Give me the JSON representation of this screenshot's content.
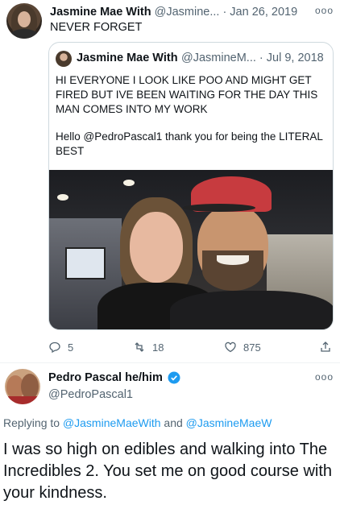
{
  "tweet": {
    "author_name": "Jasmine Mae With",
    "author_handle": "@Jasmine...",
    "date": "· Jan 26, 2019",
    "more_icon": "more-dots-icon",
    "text": "NEVER FORGET",
    "quote": {
      "author_name": "Jasmine Mae With",
      "author_handle": "@JasmineM... · Jul 9, 2018",
      "text": "HI EVERYONE I LOOK LIKE POO AND MIGHT GET FIRED BUT IVE BEEN WAITING FOR THE DAY THIS MAN COMES INTO MY WORK",
      "text2": "Hello @PedroPascal1 thank you for being the LITERAL BEST"
    },
    "actions": {
      "reply_count": "5",
      "retweet_count": "18",
      "like_count": "875"
    }
  },
  "reply": {
    "author_name": "Pedro Pascal he/him",
    "author_handle": "@PedroPascal1",
    "replying_prefix": "Replying to",
    "replying_to_1": "@JasmineMaeWith",
    "replying_and": "and",
    "replying_to_2": "@JasmineMaeW",
    "text": "I was so high on edibles and walking into The Incredibles 2. You set me on good course with your kindness."
  },
  "colors": {
    "link": "#1d9bf0",
    "secondary_text": "#536471",
    "verified": "#1d9bf0"
  }
}
